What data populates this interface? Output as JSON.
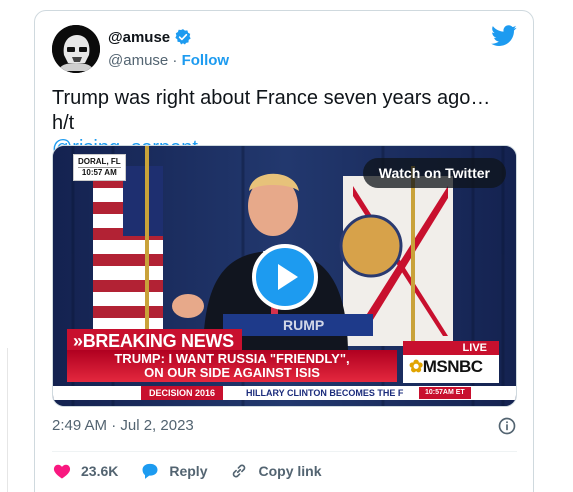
{
  "author": {
    "display_name": "@amuse",
    "handle": "@amuse",
    "separator": "·",
    "follow_label": "Follow"
  },
  "tweet": {
    "text_before": "Trump was right about France seven years ago… h/t",
    "mention": "@rising_serpent",
    "timestamp": "2:49 AM · Jul 2, 2023"
  },
  "media": {
    "watch_label": "Watch on Twitter",
    "location_line1": "DORAL, FL",
    "location_line2": "10:57 AM",
    "breaking_label": "»BREAKING NEWS",
    "headline_line1": "TRUMP: I WANT RUSSIA \"FRIENDLY\",",
    "headline_line2": "ON OUR SIDE AGAINST ISIS",
    "live_label": "LIVE",
    "network_label": "MSNBC",
    "ticker_tag": "DECISION 2016",
    "ticker_text": "HILLARY CLINTON BECOMES THE F",
    "ticker_time": "10:57AM ET"
  },
  "actions": {
    "likes_count": "23.6K",
    "reply_label": "Reply",
    "copy_link_label": "Copy link"
  },
  "colors": {
    "accent": "#1d9bf0",
    "like": "#f91880",
    "muted": "#536471",
    "breaking_red": "#c8102e"
  },
  "icons": [
    "verified-badge-icon",
    "twitter-bird-icon",
    "play-icon",
    "info-icon",
    "heart-icon",
    "reply-bubble-icon",
    "link-icon"
  ]
}
